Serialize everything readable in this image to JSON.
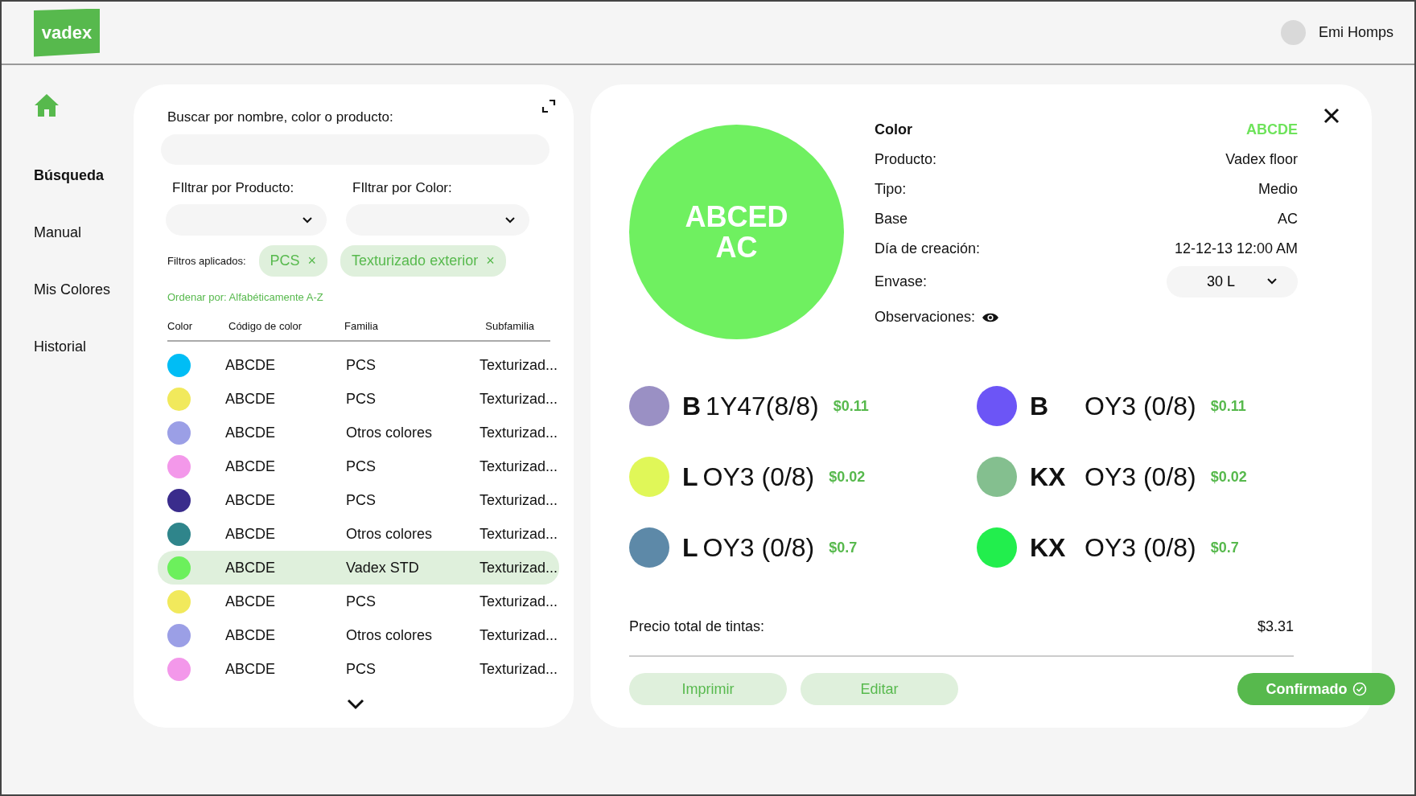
{
  "header": {
    "logo": "vadex",
    "user": "Emi Homps"
  },
  "sidebar": {
    "items": [
      {
        "label": "Búsqueda",
        "selected": true
      },
      {
        "label": "Manual",
        "selected": false
      },
      {
        "label": "Mis Colores",
        "selected": false
      },
      {
        "label": "Historial",
        "selected": false
      }
    ]
  },
  "search": {
    "label": "Buscar por nombre, color o producto:",
    "filters": [
      {
        "label": "FIltrar por Producto:"
      },
      {
        "label": "FIltrar por Color:"
      }
    ],
    "applied_label": "Filtros aplicados:",
    "chips": [
      {
        "label": "PCS",
        "remove": "×"
      },
      {
        "label": "Texturizado exterior",
        "remove": "×"
      }
    ],
    "sort": "Ordenar por: Alfabéticamente A-Z"
  },
  "table": {
    "columns": [
      "Color",
      "Código de color",
      "Familia",
      "Subfamilia"
    ],
    "rows": [
      {
        "color": "#00bdf5",
        "code": "ABCDE",
        "family": "PCS",
        "subfamily": "Texturizad...",
        "selected": false
      },
      {
        "color": "#f1e95c",
        "code": "ABCDE",
        "family": "PCS",
        "subfamily": "Texturizad...",
        "selected": false
      },
      {
        "color": "#9b9fe6",
        "code": "ABCDE",
        "family": "Otros colores",
        "subfamily": "Texturizad...",
        "selected": false
      },
      {
        "color": "#f398ea",
        "code": "ABCDE",
        "family": "PCS",
        "subfamily": "Texturizad...",
        "selected": false
      },
      {
        "color": "#3a2c8c",
        "code": "ABCDE",
        "family": "PCS",
        "subfamily": "Texturizad...",
        "selected": false
      },
      {
        "color": "#2f858b",
        "code": "ABCDE",
        "family": "Otros colores",
        "subfamily": "Texturizad...",
        "selected": false
      },
      {
        "color": "#6cf05c",
        "code": "ABCDE",
        "family": "Vadex STD",
        "subfamily": "Texturizad...",
        "selected": true
      },
      {
        "color": "#f1e95c",
        "code": "ABCDE",
        "family": "PCS",
        "subfamily": "Texturizad...",
        "selected": false
      },
      {
        "color": "#9b9fe6",
        "code": "ABCDE",
        "family": "Otros colores",
        "subfamily": "Texturizad...",
        "selected": false
      },
      {
        "color": "#f398ea",
        "code": "ABCDE",
        "family": "PCS",
        "subfamily": "Texturizad...",
        "selected": false
      }
    ]
  },
  "detail": {
    "swatch": {
      "color": "#6ff060",
      "lines": [
        "ABCED",
        "AC"
      ]
    },
    "fields": [
      {
        "label": "Color",
        "value": "ABCDE",
        "kind": "header"
      },
      {
        "label": "Producto:",
        "value": "Vadex floor",
        "kind": "text"
      },
      {
        "label": "Tipo:",
        "value": "Medio",
        "kind": "text"
      },
      {
        "label": "Base",
        "value": "AC",
        "kind": "text"
      },
      {
        "label": "Día de creación:",
        "value": "12-12-13 12:00 AM",
        "kind": "text"
      },
      {
        "label": "Envase:",
        "value": "30 L",
        "kind": "select"
      },
      {
        "label": "Observaciones:",
        "kind": "eye"
      }
    ],
    "inks": [
      {
        "color": "#9a90c4",
        "code": "B",
        "name": "1Y47(8/8)",
        "price": "$0.11"
      },
      {
        "color": "#6c55f6",
        "code": "B",
        "name": "OY3 (0/8)",
        "price": "$0.11"
      },
      {
        "color": "#e0f758",
        "code": "L",
        "name": "OY3 (0/8)",
        "price": "$0.02"
      },
      {
        "color": "#84bf8f",
        "code": "KX",
        "name": "OY3 (0/8)",
        "price": "$0.02"
      },
      {
        "color": "#5d89a8",
        "code": "L",
        "name": "OY3 (0/8)",
        "price": "$0.7"
      },
      {
        "color": "#22ee4d",
        "code": "KX",
        "name": "OY3 (0/8)",
        "price": "$0.7"
      }
    ],
    "total_label": "Precio total de tintas:",
    "total": "$3.31",
    "buttons": [
      {
        "label": "Imprimir",
        "kind": "soft"
      },
      {
        "label": "Editar",
        "kind": "soft"
      },
      {
        "label": "Confirmado",
        "kind": "primary"
      }
    ]
  }
}
